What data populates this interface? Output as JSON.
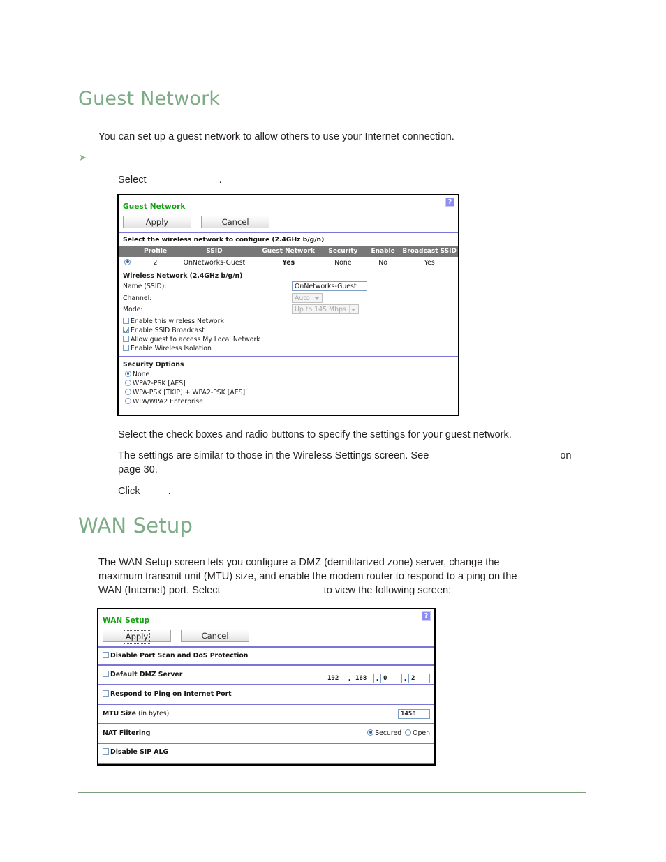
{
  "sections": [
    {
      "heading": "Guest Network",
      "intro": "You can set up a guest network to allow others to use your Internet connection.",
      "step_select_prefix": "Select",
      "step_select_suffix": ".",
      "after_text_1": "Select the check boxes and radio buttons to specify the settings for your guest network.",
      "after_text_2a": "The settings are similar to those in the Wireless Settings screen. See",
      "after_text_2b": "on",
      "after_text_2c": "page 30.",
      "click_prefix": "Click",
      "click_suffix": "."
    },
    {
      "heading": "WAN Setup",
      "intro_a": "The WAN Setup screen lets you configure a DMZ (demilitarized zone) server, change the",
      "intro_b": "maximum transmit unit (MTU) size, and enable the modem router to respond to a ping on the",
      "intro_c": "WAN (Internet) port. Select",
      "intro_d": "to view the following screen:"
    }
  ],
  "guest_panel": {
    "title": "Guest Network",
    "help_icon": "?",
    "apply_label": "Apply",
    "cancel_label": "Cancel",
    "select_network_label": "Select the wireless network to configure (2.4GHz b/g/n)",
    "table": {
      "columns": [
        "",
        "Profile",
        "SSID",
        "Guest Network",
        "Security",
        "Enable",
        "Broadcast SSID"
      ],
      "rows": [
        {
          "selected": true,
          "profile": "2",
          "ssid": "OnNetworks-Guest",
          "guest_network": "Yes",
          "security": "None",
          "enable": "No",
          "broadcast_ssid": "Yes"
        }
      ]
    },
    "wireless_section_label": "Wireless Network (2.4GHz b/g/n)",
    "name_ssid_label": "Name (SSID):",
    "name_ssid_value": "OnNetworks-Guest",
    "channel_label": "Channel:",
    "channel_value": "Auto",
    "mode_label": "Mode:",
    "mode_value": "Up to 145 Mbps",
    "checkboxes": [
      {
        "label": "Enable this wireless Network",
        "checked": false
      },
      {
        "label": "Enable SSID Broadcast",
        "checked": true
      },
      {
        "label": "Allow guest to access My Local Network",
        "checked": false
      },
      {
        "label": "Enable Wireless Isolation",
        "checked": false
      }
    ],
    "security_options_label": "Security Options",
    "security_options": [
      {
        "label": "None",
        "checked": true
      },
      {
        "label": "WPA2-PSK [AES]",
        "checked": false
      },
      {
        "label": "WPA-PSK [TKIP] + WPA2-PSK [AES]",
        "checked": false
      },
      {
        "label": "WPA/WPA2 Enterprise",
        "checked": false
      }
    ]
  },
  "wan_panel": {
    "title": "WAN Setup",
    "help_icon": "?",
    "apply_label": "Apply",
    "cancel_label": "Cancel",
    "rows": {
      "disable_port_scan_label": "Disable Port Scan and DoS Protection",
      "disable_port_scan_checked": false,
      "default_dmz_label": "Default DMZ Server",
      "default_dmz_checked": false,
      "dmz_ip": [
        "192",
        "168",
        "0",
        "2"
      ],
      "respond_ping_label": "Respond to Ping on Internet Port",
      "respond_ping_checked": false,
      "mtu_label_bold": "MTU Size",
      "mtu_label_normal": "(in bytes)",
      "mtu_value": "1458",
      "nat_filtering_label": "NAT Filtering",
      "nat_secured_label": "Secured",
      "nat_open_label": "Open",
      "nat_selected": "Secured",
      "disable_sip_label": "Disable SIP ALG",
      "disable_sip_checked": false
    }
  },
  "colors": {
    "heading_green": "#7cab86",
    "panel_title_green": "#12a012",
    "divider_violet": "#7a76d6",
    "table_header_gray": "#787878",
    "help_purple": "#8d8ef0",
    "page_rule_green": "#7d9e7d"
  }
}
